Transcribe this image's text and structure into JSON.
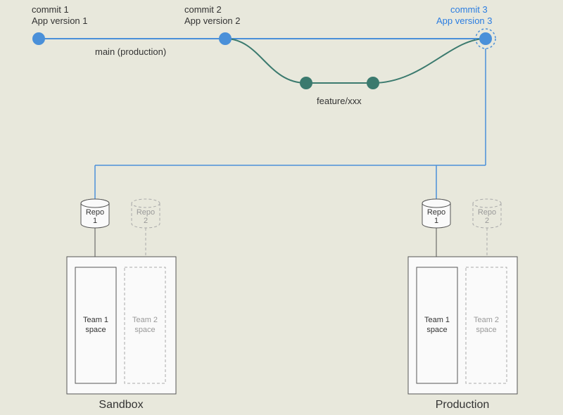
{
  "commits": {
    "c1_line1": "commit 1",
    "c1_line2": "App version 1",
    "c2_line1": "commit 2",
    "c2_line2": "App version 2",
    "c3_line1": "commit 3",
    "c3_line2": "App version 3"
  },
  "branches": {
    "main": "main (production)",
    "feature": "feature/xxx"
  },
  "repos": {
    "repo1": "Repo 1",
    "repo2": "Repo 2"
  },
  "spaces": {
    "team1": "Team 1 space",
    "team2": "Team 2 space"
  },
  "environments": {
    "sandbox": "Sandbox",
    "production": "Production"
  },
  "colors": {
    "bg": "#e8e8dc",
    "main_line": "#4a90d9",
    "commit_node": "#4a90d9",
    "feature_line": "#3b7a6e",
    "feature_node": "#3b7a6e",
    "commit3_ring": "#4a90d9",
    "box_border": "#555",
    "box_fill": "#fafafa",
    "dashed_border": "#aaa"
  },
  "chart_data": {
    "type": "diagram",
    "title": "Git branching and deployment to environments",
    "annotations": [],
    "nodes": [
      {
        "id": "commit1",
        "branch": "main",
        "label": "commit 1 / App version 1"
      },
      {
        "id": "commit2",
        "branch": "main",
        "label": "commit 2 / App version 2"
      },
      {
        "id": "feature_a",
        "branch": "feature/xxx",
        "label": ""
      },
      {
        "id": "feature_b",
        "branch": "feature/xxx",
        "label": ""
      },
      {
        "id": "commit3",
        "branch": "main",
        "label": "commit 3 / App version 3",
        "highlight": true
      }
    ],
    "edges": [
      {
        "from": "commit1",
        "to": "commit2",
        "branch": "main"
      },
      {
        "from": "commit2",
        "to": "commit3",
        "branch": "main"
      },
      {
        "from": "commit2",
        "to": "feature_a",
        "branch": "feature/xxx"
      },
      {
        "from": "feature_a",
        "to": "feature_b",
        "branch": "feature/xxx"
      },
      {
        "from": "feature_b",
        "to": "commit3",
        "branch": "feature/xxx"
      },
      {
        "from": "commit3",
        "to": "sandbox.repo1",
        "type": "deploy"
      },
      {
        "from": "commit3",
        "to": "production.repo1",
        "type": "deploy"
      }
    ],
    "environments": [
      {
        "name": "Sandbox",
        "repos": [
          "Repo 1",
          "Repo 2"
        ],
        "spaces": [
          "Team 1 space",
          "Team 2 space"
        ]
      },
      {
        "name": "Production",
        "repos": [
          "Repo 1",
          "Repo 2"
        ],
        "spaces": [
          "Team 1 space",
          "Team 2 space"
        ]
      }
    ]
  }
}
